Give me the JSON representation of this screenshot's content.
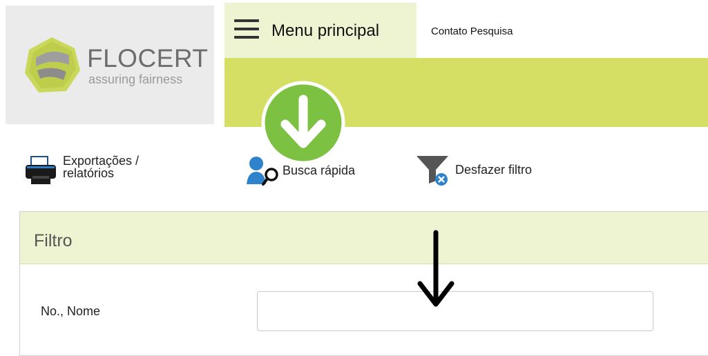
{
  "brand": {
    "name": "FLOCERT",
    "tagline": "assuring fairness",
    "colors": {
      "accent_green": "#d4df63",
      "pale_green": "#eef3d1",
      "badge_green": "#7cc142"
    }
  },
  "topbar": {
    "menu_label": "Menu principal",
    "contact_label": "Contato Pesquisa"
  },
  "toolbar": {
    "export_label_line1": "Exportações /",
    "export_label_line2": "relatórios",
    "quick_search_label": "Busca rápida",
    "undo_filter_label": "Desfazer filtro"
  },
  "filter": {
    "title": "Filtro",
    "field_label": "No., Nome",
    "field_value": "",
    "field_placeholder": ""
  },
  "icons": [
    "hamburger-icon",
    "download-arrow-icon",
    "printer-icon",
    "user-search-icon",
    "funnel-clear-icon",
    "down-arrow-icon"
  ]
}
